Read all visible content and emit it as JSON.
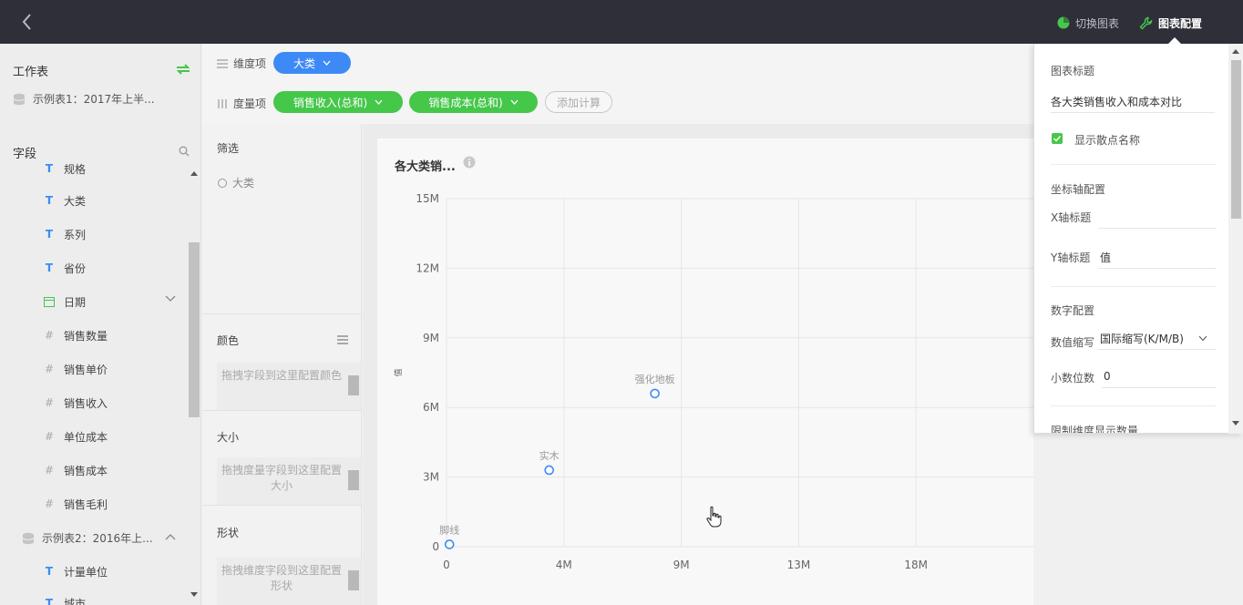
{
  "topbar": {
    "switch_label": "切换图表",
    "config_label": "图表配置",
    "colors": {
      "background": "#2f2f3a",
      "switch_icon": "#45c74a",
      "config_icon": "#45c74a"
    }
  },
  "left_panel": {
    "workbook_label": "工作表",
    "table1": {
      "name": "示例表1：2017年上半...",
      "icon": "database-icon"
    },
    "fields_label": "字段",
    "fields": [
      {
        "name": "规格",
        "type": "T"
      },
      {
        "name": "大类",
        "type": "T"
      },
      {
        "name": "系列",
        "type": "T"
      },
      {
        "name": "省份",
        "type": "T"
      },
      {
        "name": "日期",
        "type": "date"
      },
      {
        "name": "销售数量",
        "type": "#"
      },
      {
        "name": "销售单价",
        "type": "#"
      },
      {
        "name": "销售收入",
        "type": "#"
      },
      {
        "name": "单位成本",
        "type": "#"
      },
      {
        "name": "销售成本",
        "type": "#"
      },
      {
        "name": "销售毛利",
        "type": "#"
      }
    ],
    "table2": {
      "name": "示例表2：2016年上...",
      "icon": "database-icon"
    },
    "table2_fields": [
      {
        "name": "计量单位",
        "type": "T"
      },
      {
        "name": "城市",
        "type": "T"
      }
    ]
  },
  "dimension_bar": {
    "dimension_label": "维度项",
    "dimension_pills": [
      "大类"
    ],
    "measure_label": "度量项",
    "measure_pills": [
      "销售收入(总和)",
      "销售成本(总和)"
    ],
    "add_calc_label": "添加计算"
  },
  "filter_panel": {
    "filter_label": "筛选",
    "filter_items": [
      "大类"
    ],
    "color_label": "颜色",
    "color_hint": "拖拽字段到这里配置颜色",
    "size_label": "大小",
    "size_hint": "拖拽度量字段到这里配置大小",
    "shape_label": "形状",
    "shape_hint": "拖拽维度字段到这里配置形状"
  },
  "chart_card": {
    "title": "各大类销..."
  },
  "chart_data": {
    "type": "scatter",
    "title": "各大类销...",
    "xlabel": "",
    "ylabel": "值",
    "xlim": [
      0,
      20000000
    ],
    "ylim": [
      0,
      15000000
    ],
    "x_ticks": [
      0,
      4000000,
      8000000,
      12000000,
      16000000
    ],
    "x_tick_labels": [
      "0",
      "4M",
      "9M",
      "13M",
      "18M"
    ],
    "y_ticks": [
      0,
      3000000,
      6000000,
      9000000,
      12000000,
      15000000
    ],
    "y_tick_labels": [
      "0",
      "3M",
      "6M",
      "9M",
      "12M",
      "15M"
    ],
    "grid": true,
    "points": [
      {
        "label": "脚线",
        "x": 100000,
        "y": 100000
      },
      {
        "label": "实木",
        "x": 3500000,
        "y": 3300000
      },
      {
        "label": "强化地板",
        "x": 7100000,
        "y": 6600000
      }
    ],
    "colors": {
      "point": "#3d8af7",
      "grid": "#e6e6e6",
      "label": "#999999"
    }
  },
  "config_panel": {
    "chart_title_label": "图表标题",
    "chart_title_value": "各大类销售收入和成本对比",
    "show_point_name_label": "显示散点名称",
    "show_point_name_checked": true,
    "axis_config_label": "坐标轴配置",
    "x_axis_title_label": "X轴标题",
    "x_axis_title_value": "",
    "y_axis_title_label": "Y轴标题",
    "y_axis_title_value": "值",
    "number_config_label": "数字配置",
    "abbr_label": "数值缩写",
    "abbr_value": "国际缩写(K/M/B)",
    "decimal_label": "小数位数",
    "decimal_value": "0",
    "limit_label": "限制维度显示数量"
  }
}
